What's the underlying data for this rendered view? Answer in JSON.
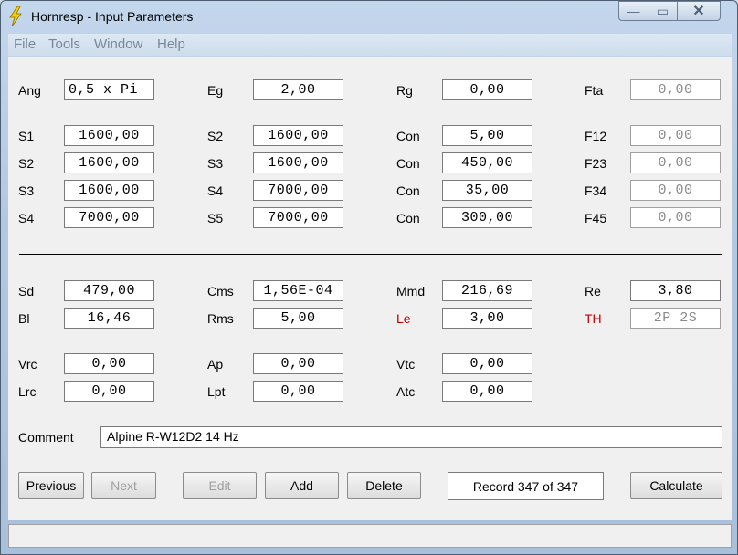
{
  "window": {
    "title": "Hornresp - Input Parameters",
    "close_glyph": "✕",
    "min_glyph": "—",
    "max_glyph": "▭"
  },
  "menu": [
    "File",
    "Tools",
    "Window",
    "Help"
  ],
  "fields": {
    "ang": {
      "label": "Ang",
      "value": "0,5 x Pi"
    },
    "eg": {
      "label": "Eg",
      "value": "2,00"
    },
    "rg": {
      "label": "Rg",
      "value": "0,00"
    },
    "fta": {
      "label": "Fta",
      "value": "0,00"
    },
    "s1": {
      "label": "S1",
      "value": "1600,00"
    },
    "s2a": {
      "label": "S2",
      "value": "1600,00"
    },
    "con1": {
      "label": "Con",
      "value": "5,00"
    },
    "f12": {
      "label": "F12",
      "value": "0,00"
    },
    "s2": {
      "label": "S2",
      "value": "1600,00"
    },
    "s3a": {
      "label": "S3",
      "value": "1600,00"
    },
    "con2": {
      "label": "Con",
      "value": "450,00"
    },
    "f23": {
      "label": "F23",
      "value": "0,00"
    },
    "s3": {
      "label": "S3",
      "value": "1600,00"
    },
    "s4a": {
      "label": "S4",
      "value": "7000,00"
    },
    "con3": {
      "label": "Con",
      "value": "35,00"
    },
    "f34": {
      "label": "F34",
      "value": "0,00"
    },
    "s4": {
      "label": "S4",
      "value": "7000,00"
    },
    "s5": {
      "label": "S5",
      "value": "7000,00"
    },
    "con4": {
      "label": "Con",
      "value": "300,00"
    },
    "f45": {
      "label": "F45",
      "value": "0,00"
    },
    "sd": {
      "label": "Sd",
      "value": "479,00"
    },
    "cms": {
      "label": "Cms",
      "value": "1,56E-04"
    },
    "mmd": {
      "label": "Mmd",
      "value": "216,69"
    },
    "re": {
      "label": "Re",
      "value": "3,80"
    },
    "bl": {
      "label": "Bl",
      "value": "16,46"
    },
    "rms": {
      "label": "Rms",
      "value": "5,00"
    },
    "le": {
      "label": "Le",
      "value": "3,00"
    },
    "th": {
      "label": "TH",
      "value": "2P 2S"
    },
    "vrc": {
      "label": "Vrc",
      "value": "0,00"
    },
    "ap": {
      "label": "Ap",
      "value": "0,00"
    },
    "vtc": {
      "label": "Vtc",
      "value": "0,00"
    },
    "lrc": {
      "label": "Lrc",
      "value": "0,00"
    },
    "lpt": {
      "label": "Lpt",
      "value": "0,00"
    },
    "atc": {
      "label": "Atc",
      "value": "0,00"
    }
  },
  "comment": {
    "label": "Comment",
    "value": "Alpine R-W12D2 14 Hz"
  },
  "buttons": {
    "previous": "Previous",
    "next": "Next",
    "edit": "Edit",
    "add": "Add",
    "delete": "Delete",
    "calculate": "Calculate"
  },
  "record": "Record 347 of 347",
  "colors": {
    "accent_red": "#c00000",
    "title_blue": "#b2c9e2"
  }
}
